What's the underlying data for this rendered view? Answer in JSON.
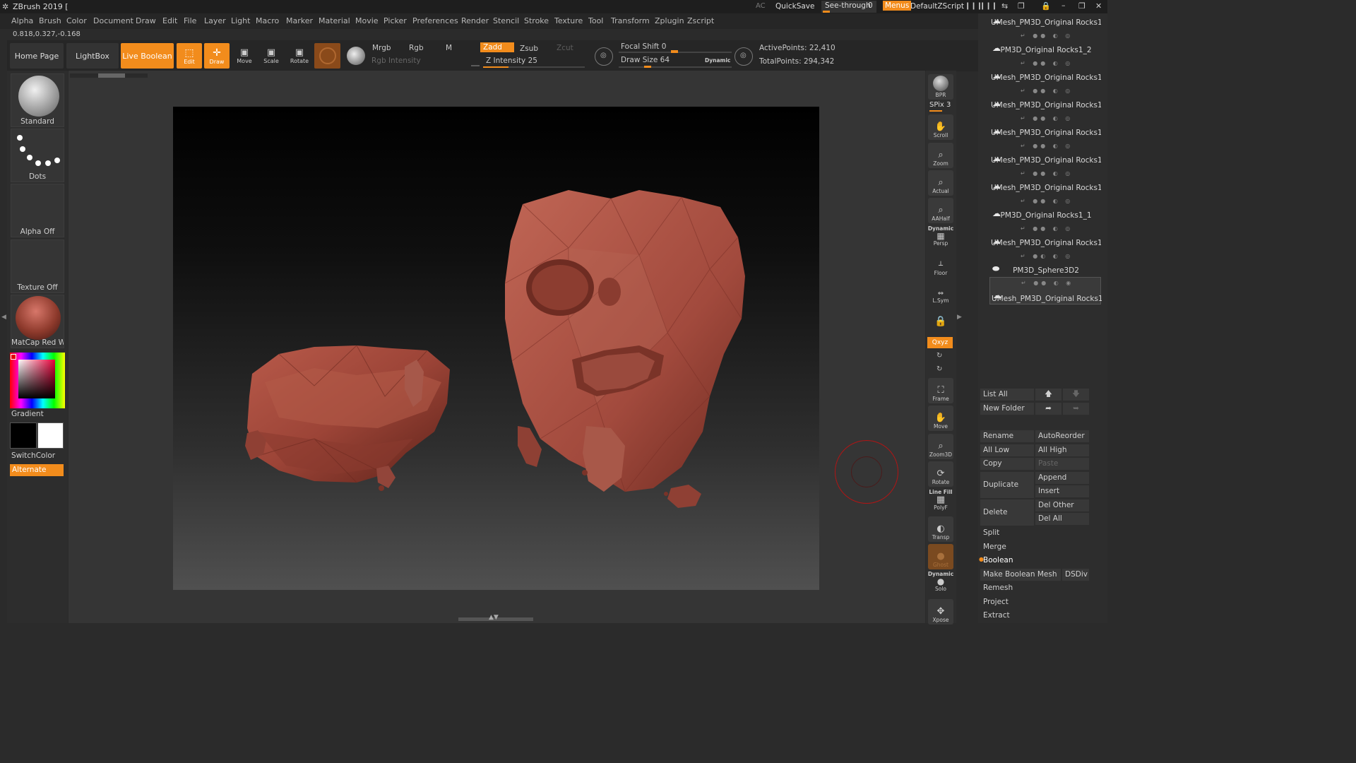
{
  "titlebar": {
    "app_title": "ZBrush 2019 [",
    "ac": "AC",
    "quicksave": "QuickSave",
    "see_through": "See-through",
    "see_through_value": "0",
    "menus": "Menus",
    "script": "DefaultZScript"
  },
  "menus": [
    "Alpha",
    "Brush",
    "Color",
    "Document",
    "Draw",
    "Edit",
    "File",
    "Layer",
    "Light",
    "Macro",
    "Marker",
    "Material",
    "Movie",
    "Picker",
    "Preferences",
    "Render",
    "Stencil",
    "Stroke",
    "Texture",
    "Tool",
    "Transform",
    "Zplugin",
    "Zscript"
  ],
  "coords": "0.818,0.327,-0.168",
  "toolbar": {
    "home_page": "Home Page",
    "lightbox": "LightBox",
    "live_boolean": "Live Boolean",
    "edit": "Edit",
    "draw": "Draw",
    "move": "Move",
    "scale": "Scale",
    "rotate": "Rotate",
    "mrgb": "Mrgb",
    "rgb": "Rgb",
    "m": "M",
    "zadd": "Zadd",
    "zsub": "Zsub",
    "zcut": "Zcut",
    "rgb_intensity": "Rgb Intensity",
    "z_intensity": "Z Intensity 25",
    "z_intensity_level": 25,
    "focal_shift": "Focal Shift 0",
    "draw_size": "Draw Size 64",
    "dynamic": "Dynamic",
    "active_points": "ActivePoints: 22,410",
    "total_points": "TotalPoints: 294,342"
  },
  "left_shelf": {
    "brush": "Standard",
    "stroke": "Dots",
    "alpha": "Alpha Off",
    "texture": "Texture Off",
    "material": "MatCap Red Wax",
    "gradient": "Gradient",
    "switch_color": "SwitchColor",
    "alternate": "Alternate"
  },
  "right_shelf": {
    "bpr": "BPR",
    "spix": "SPix 3",
    "scroll": "Scroll",
    "zoom": "Zoom",
    "actual": "Actual",
    "aahalf": "AAHalf",
    "dynamic": "Dynamic",
    "persp": "Persp",
    "floor": "Floor",
    "lsym": "L.Sym",
    "xyz": "Qxyz",
    "frame": "Frame",
    "move": "Move",
    "zoom3d": "Zoom3D",
    "rotate": "Rotate",
    "line_fill": "Line Fill",
    "polyf": "PolyF",
    "transp": "Transp",
    "ghost": "Ghost",
    "dynamic2": "Dynamic",
    "solo": "Solo",
    "xpose": "Xpose"
  },
  "subtools": [
    {
      "name": "UMesh_PM3D_Original Rocks1"
    },
    {
      "name": "PM3D_Original Rocks1_2"
    },
    {
      "name": "UMesh_PM3D_Original Rocks1"
    },
    {
      "name": "UMesh_PM3D_Original Rocks1"
    },
    {
      "name": "UMesh_PM3D_Original Rocks1"
    },
    {
      "name": "UMesh_PM3D_Original Rocks1"
    },
    {
      "name": "UMesh_PM3D_Original Rocks1"
    },
    {
      "name": "PM3D_Original Rocks1_1"
    },
    {
      "name": "UMesh_PM3D_Original Rocks1"
    },
    {
      "name": "PM3D_Sphere3D2"
    },
    {
      "name": "UMesh_PM3D_Original Rocks1"
    }
  ],
  "subtool_panel": {
    "list_all": "List All",
    "new_folder": "New Folder",
    "rename": "Rename",
    "auto_reorder": "AutoReorder",
    "all_low": "All Low",
    "all_high": "All High",
    "copy": "Copy",
    "paste": "Paste",
    "duplicate": "Duplicate",
    "append": "Append",
    "insert": "Insert",
    "delete": "Delete",
    "del_other": "Del Other",
    "del_all": "Del All",
    "split": "Split",
    "merge": "Merge",
    "boolean": "Boolean",
    "make_boolean_mesh": "Make Boolean Mesh",
    "dsdiv": "DSDiv",
    "remesh": "Remesh",
    "project": "Project",
    "extract": "Extract"
  },
  "colors": {
    "accent": "#f28c1c",
    "rock": "#a44b3e",
    "background": "#2b2b2b"
  }
}
